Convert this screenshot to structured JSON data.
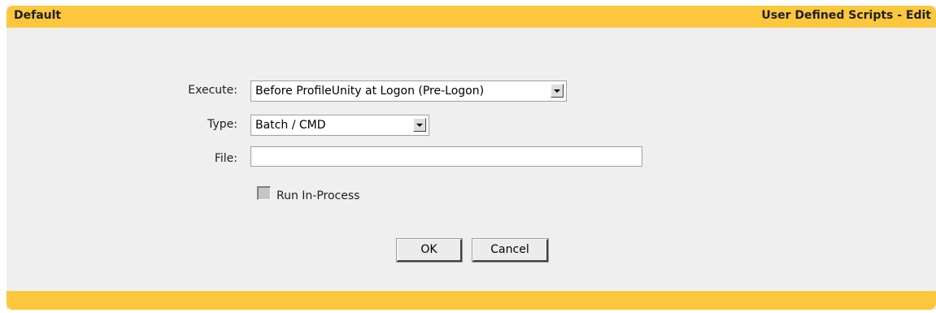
{
  "header": {
    "left_title": "Default",
    "right_title": "User Defined Scripts - Edit"
  },
  "form": {
    "execute": {
      "label": "Execute:",
      "value": "Before ProfileUnity at Logon (Pre-Logon)"
    },
    "type": {
      "label": "Type:",
      "value": "Batch / CMD"
    },
    "file": {
      "label": "File:",
      "value": ""
    },
    "run_in_process": {
      "label": "Run In-Process",
      "checked": false
    }
  },
  "buttons": {
    "ok_label": "OK",
    "cancel_label": "Cancel"
  },
  "colors": {
    "header_bar": "#fbc73c",
    "panel_bg": "#efefef"
  }
}
